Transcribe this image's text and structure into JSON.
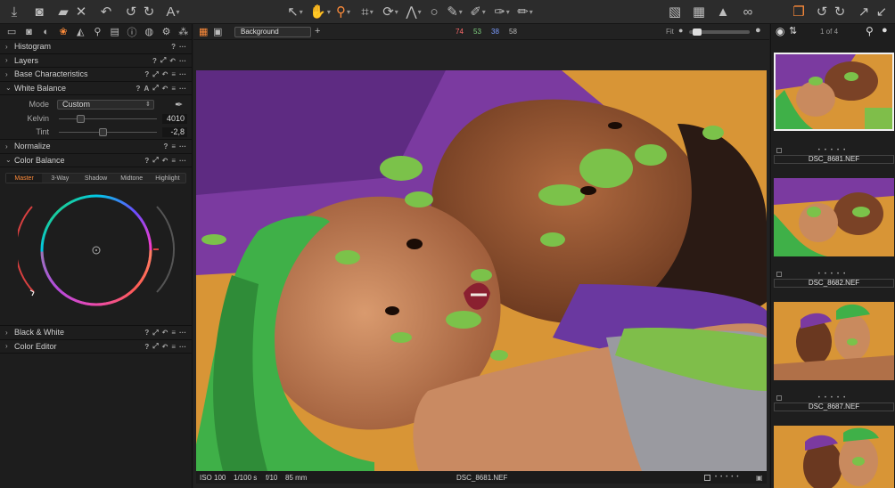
{
  "toolbar": {
    "icons_left": [
      "import-icon",
      "camera-icon",
      "folder-move-icon",
      "close-icon",
      "undo-all-icon",
      "undo-icon",
      "redo-icon",
      "text-icon"
    ],
    "icons_center": [
      "select-cursor-icon",
      "pan-hand-icon",
      "loupe-icon",
      "crop-icon",
      "rotate-icon",
      "keystone-icon",
      "circle-mask-icon",
      "brush-icon",
      "eraser-icon",
      "fill-icon",
      "gradient-icon"
    ],
    "icons_right": [
      "proof-icon",
      "grid-icon",
      "exposure-warning-icon",
      "glasses-icon",
      "copy-adjust-icon",
      "rotate-left-icon",
      "rotate-right-icon",
      "expand-icon",
      "collapse-icon"
    ]
  },
  "left_panel": {
    "tool_tabs": [
      "library",
      "capture",
      "lens",
      "color",
      "exposure",
      "detail",
      "metadata",
      "adjust",
      "output",
      "batch",
      "styles"
    ],
    "sections": {
      "histogram": "Histogram",
      "layers": "Layers",
      "base_characteristics": "Base Characteristics",
      "white_balance": "White Balance",
      "normalize": "Normalize",
      "color_balance": "Color Balance",
      "black_white": "Black & White",
      "color_editor": "Color Editor"
    },
    "white_balance": {
      "mode_label": "Mode",
      "mode_value": "Custom",
      "kelvin_label": "Kelvin",
      "kelvin_value": "4010",
      "tint_label": "Tint",
      "tint_value": "-2,8",
      "a_label": "A"
    },
    "color_balance_tabs": [
      "Master",
      "3-Way",
      "Shadow",
      "Midtone",
      "Highlight"
    ],
    "help_mark": "?",
    "more_mark": "···"
  },
  "viewer": {
    "layer_select": "Background",
    "readout": {
      "r": "74",
      "g": "53",
      "b": "38",
      "l": "58"
    },
    "colors": {
      "r": "#ff6b6b",
      "g": "#7fd07f",
      "b": "#7b9cff",
      "l": "#bbbbbb"
    },
    "fit_label": "Fit",
    "status": {
      "iso": "ISO 100",
      "shutter": "1/100 s",
      "aperture": "f/10",
      "focal": "85 mm",
      "filename": "DSC_8681.NEF"
    }
  },
  "browser": {
    "counter": "1 of 4",
    "stars": "•••••",
    "thumbnails": [
      {
        "name": "DSC_8681.NEF"
      },
      {
        "name": "DSC_8682.NEF"
      },
      {
        "name": "DSC_8687.NEF"
      },
      {
        "name": ""
      }
    ]
  },
  "accent_color": "#ff8c3a"
}
